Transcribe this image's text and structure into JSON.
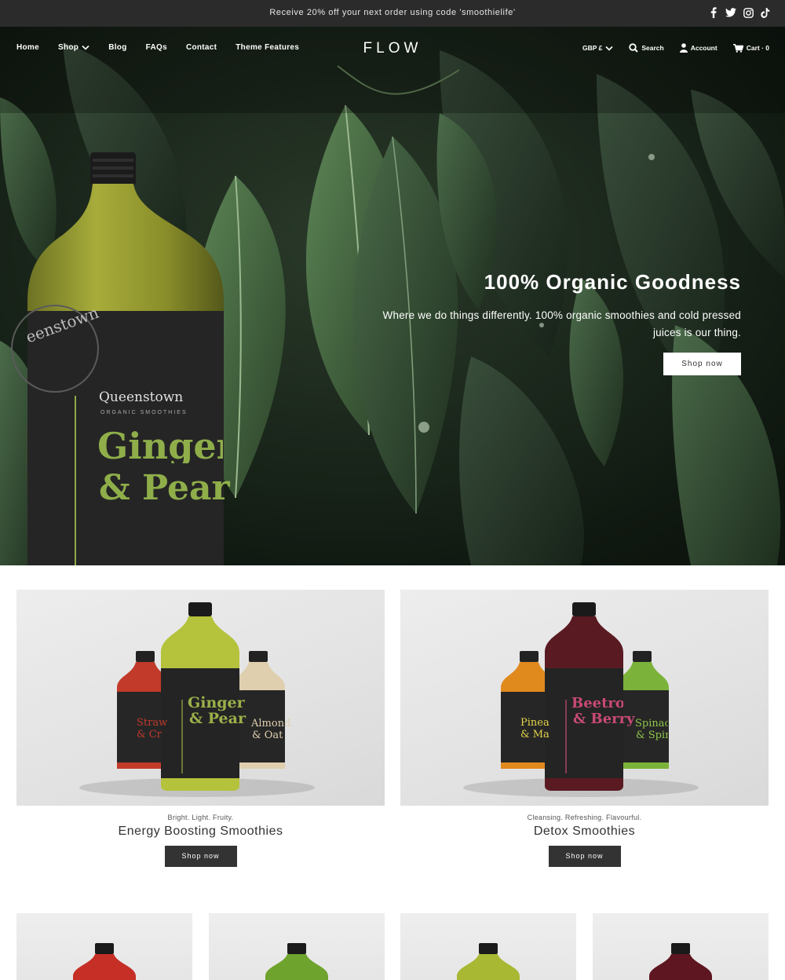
{
  "announcement": {
    "message": "Receive 20% off your next order using code 'smoothielife'",
    "social": [
      "facebook-icon",
      "twitter-icon",
      "instagram-icon",
      "tiktok-icon"
    ]
  },
  "nav": {
    "links": [
      {
        "label": "Home"
      },
      {
        "label": "Shop",
        "dropdown": true
      },
      {
        "label": "Blog"
      },
      {
        "label": "FAQs"
      },
      {
        "label": "Contact"
      },
      {
        "label": "Theme Features"
      }
    ],
    "logo": "FLOW",
    "currency": "GBP £",
    "search": "Search",
    "account": "Account",
    "cart": "Cart · 0"
  },
  "hero": {
    "title": "100% Organic Goodness",
    "subtitle": "Where we do things differently. 100% organic smoothies and cold pressed juices is our thing.",
    "button": "Shop now",
    "bottle": {
      "brand": "Queenstown",
      "line": "ORGANIC SMOOTHIES",
      "flavor_1": "Ginger",
      "flavor_2": "& Pear"
    }
  },
  "collections": [
    {
      "tagline": "Bright. Light. Fruity.",
      "title": "Energy Boosting Smoothies",
      "button": "Shop now",
      "bottles": {
        "left": {
          "flavor_1": "Straw",
          "flavor_2": "& Cr"
        },
        "center": {
          "flavor_1": "Ginger",
          "flavor_2": "& Pear"
        },
        "right": {
          "flavor_1": "Almond",
          "flavor_2": "& Oat"
        }
      }
    },
    {
      "tagline": "Cleansing. Refreshing. Flavourful.",
      "title": "Detox Smoothies",
      "button": "Shop now",
      "bottles": {
        "left": {
          "flavor_1": "Pinea",
          "flavor_2": "& Ma"
        },
        "center": {
          "flavor_1": "Beetroot",
          "flavor_2": "& Berry"
        },
        "right": {
          "flavor_1": "Spinach",
          "flavor_2": "& Spiru"
        }
      }
    }
  ],
  "colors": {
    "announce_bg": "#2b2b2b",
    "button_dark": "#333333",
    "hero_bg": "#142016"
  }
}
